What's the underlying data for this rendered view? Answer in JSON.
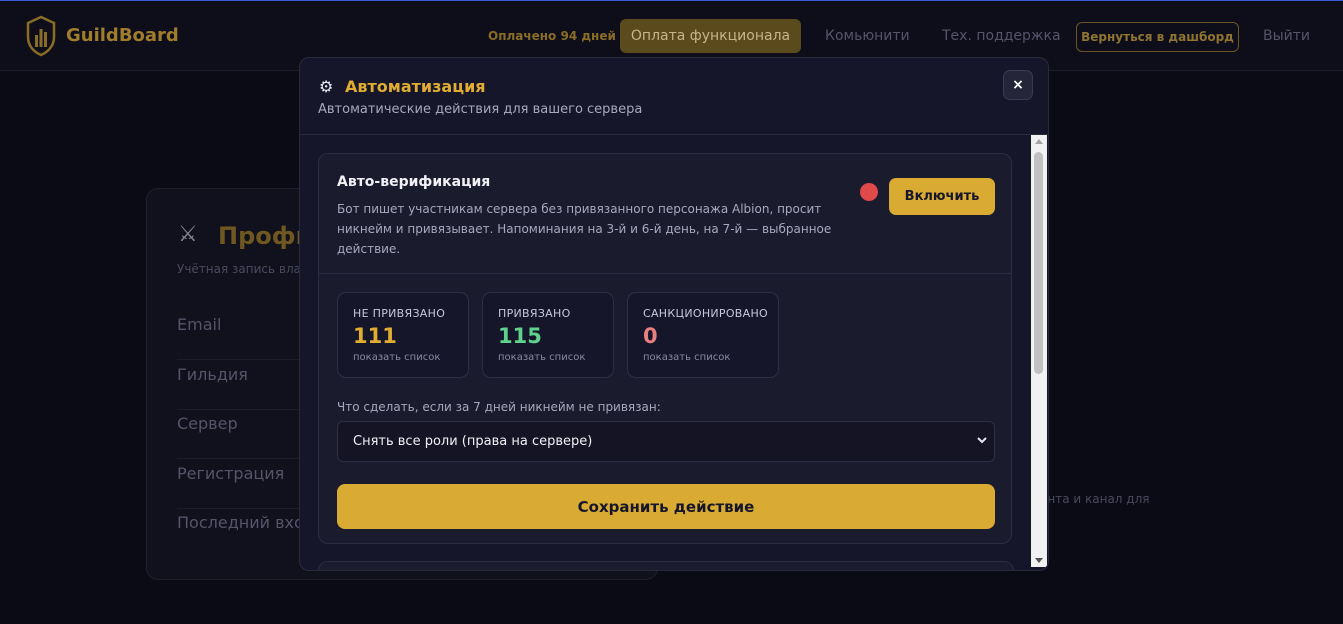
{
  "header": {
    "logo_text": "GuildBoard",
    "paid_status": "Оплачено 94 дней",
    "pay_button": "Оплата функционала",
    "community_link": "Комьюнити",
    "support_link": "Тех. поддержка",
    "back_button": "Вернуться в дашборд",
    "logout_link": "Выйти"
  },
  "profile": {
    "title": "Профи",
    "subtitle": "Учётная запись вла",
    "rows": [
      "Email",
      "Гильдия",
      "Сервер",
      "Регистрация",
      "Последний вход"
    ]
  },
  "background_text": "ента и канал для",
  "modal": {
    "title": "Автоматизация",
    "subtitle": "Автоматические действия для вашего сервера",
    "close_label": "×",
    "auto_verify": {
      "title": "Авто-верификация",
      "description": "Бот пишет участникам сервера без привязанного персонажа Albion, просит никнейм и привязывает. Напоминания на 3-й и 6-й день, на 7-й — выбранное действие.",
      "enable_button": "Включить",
      "status_color": "#e04a4a",
      "stats": [
        {
          "label": "НЕ ПРИВЯЗАНО",
          "value": "111",
          "link": "показать список",
          "color": "#e0ad32"
        },
        {
          "label": "ПРИВЯЗАНО",
          "value": "115",
          "link": "показать список",
          "color": "#5fd38d"
        },
        {
          "label": "САНКЦИОНИРОВАНО",
          "value": "0",
          "link": "показать список",
          "color": "#e88080"
        }
      ],
      "action_label": "Что сделать, если за 7 дней никнейм не привязан:",
      "action_selected": "Снять все роли (права на сервере)",
      "save_button": "Сохранить действие"
    }
  },
  "colors": {
    "accent": "#d9ab33",
    "background": "#0b0b16",
    "modal_bg": "#16162a"
  }
}
